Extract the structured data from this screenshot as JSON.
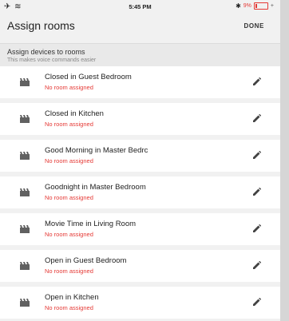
{
  "status": {
    "left_icons": "✈ ≋",
    "time": "5:45 PM",
    "bluetooth": "✱",
    "battery_pct": "9%",
    "plug": "+"
  },
  "appbar": {
    "title": "Assign rooms",
    "done_label": "DONE"
  },
  "section": {
    "title": "Assign devices to rooms",
    "subtitle": "This makes voice commands easier"
  },
  "items": [
    {
      "name": "Closed in Guest Bedroom",
      "room": "No room assigned"
    },
    {
      "name": "Closed in Kitchen",
      "room": "No room assigned"
    },
    {
      "name": "Good Morning in Master Bedrc",
      "room": "No room assigned"
    },
    {
      "name": "Goodnight in Master Bedroom",
      "room": "No room assigned"
    },
    {
      "name": "Movie Time in Living Room",
      "room": "No room assigned"
    },
    {
      "name": "Open in Guest Bedroom",
      "room": "No room assigned"
    },
    {
      "name": "Open in Kitchen",
      "room": "No room assigned"
    }
  ],
  "colors": {
    "accent_red": "#e53935",
    "icon_gray": "#616161"
  },
  "icons": {
    "scene": "clapperboard-icon",
    "edit": "pencil-icon"
  }
}
